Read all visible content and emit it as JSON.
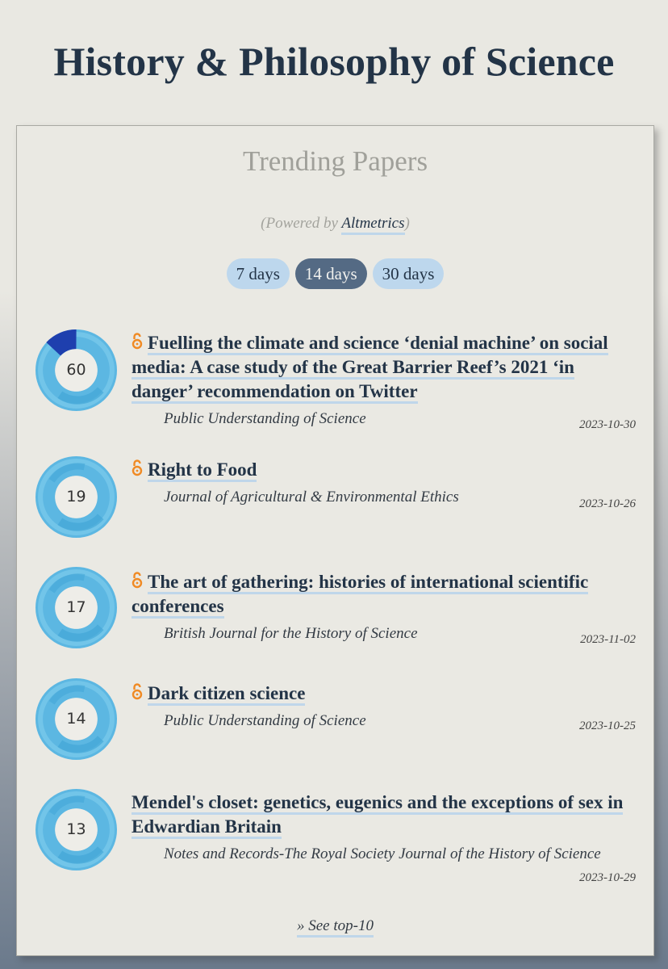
{
  "site": {
    "title": "History & Philosophy of Science"
  },
  "widget": {
    "title": "Trending Papers",
    "powered_prefix": "(Powered by ",
    "powered_link": "Altmetrics",
    "powered_suffix": ")",
    "tabs": [
      {
        "label": "7 days",
        "active": false
      },
      {
        "label": "14 days",
        "active": true
      },
      {
        "label": "30 days",
        "active": false
      }
    ],
    "see_more": "» See top-10"
  },
  "colors": {
    "title": "#233447",
    "tab_inactive": "#bdd7ed",
    "tab_active": "#546a84",
    "link_underline": "#bfd6ea",
    "open_access": "#f08a24",
    "badge_light": "#5bb8e3",
    "badge_dark": "#1f3fb0"
  },
  "papers": [
    {
      "score": "60",
      "open_access": true,
      "title": "Fuelling the climate and science ‘denial machine’ on social media: A case study of the Great Barrier Reef’s 2021 ‘in danger’ recommendation on Twitter",
      "journal": "Public Understanding of Science",
      "date": "2023-10-30"
    },
    {
      "score": "19",
      "open_access": true,
      "title": "Right to Food",
      "journal": "Journal of Agricultural & Environmental Ethics",
      "date": "2023-10-26"
    },
    {
      "score": "17",
      "open_access": true,
      "title": "The art of gathering: histories of international scientific conferences",
      "journal": "British Journal for the History of Science",
      "date": "2023-11-02"
    },
    {
      "score": "14",
      "open_access": true,
      "title": "Dark citizen science",
      "journal": "Public Understanding of Science",
      "date": "2023-10-25"
    },
    {
      "score": "13",
      "open_access": false,
      "title": "Mendel's closet: genetics, eugenics and the exceptions of sex in Edwardian Britain",
      "journal": "Notes and Records-The Royal Society Journal of the History of Science",
      "date": "2023-10-29"
    }
  ]
}
